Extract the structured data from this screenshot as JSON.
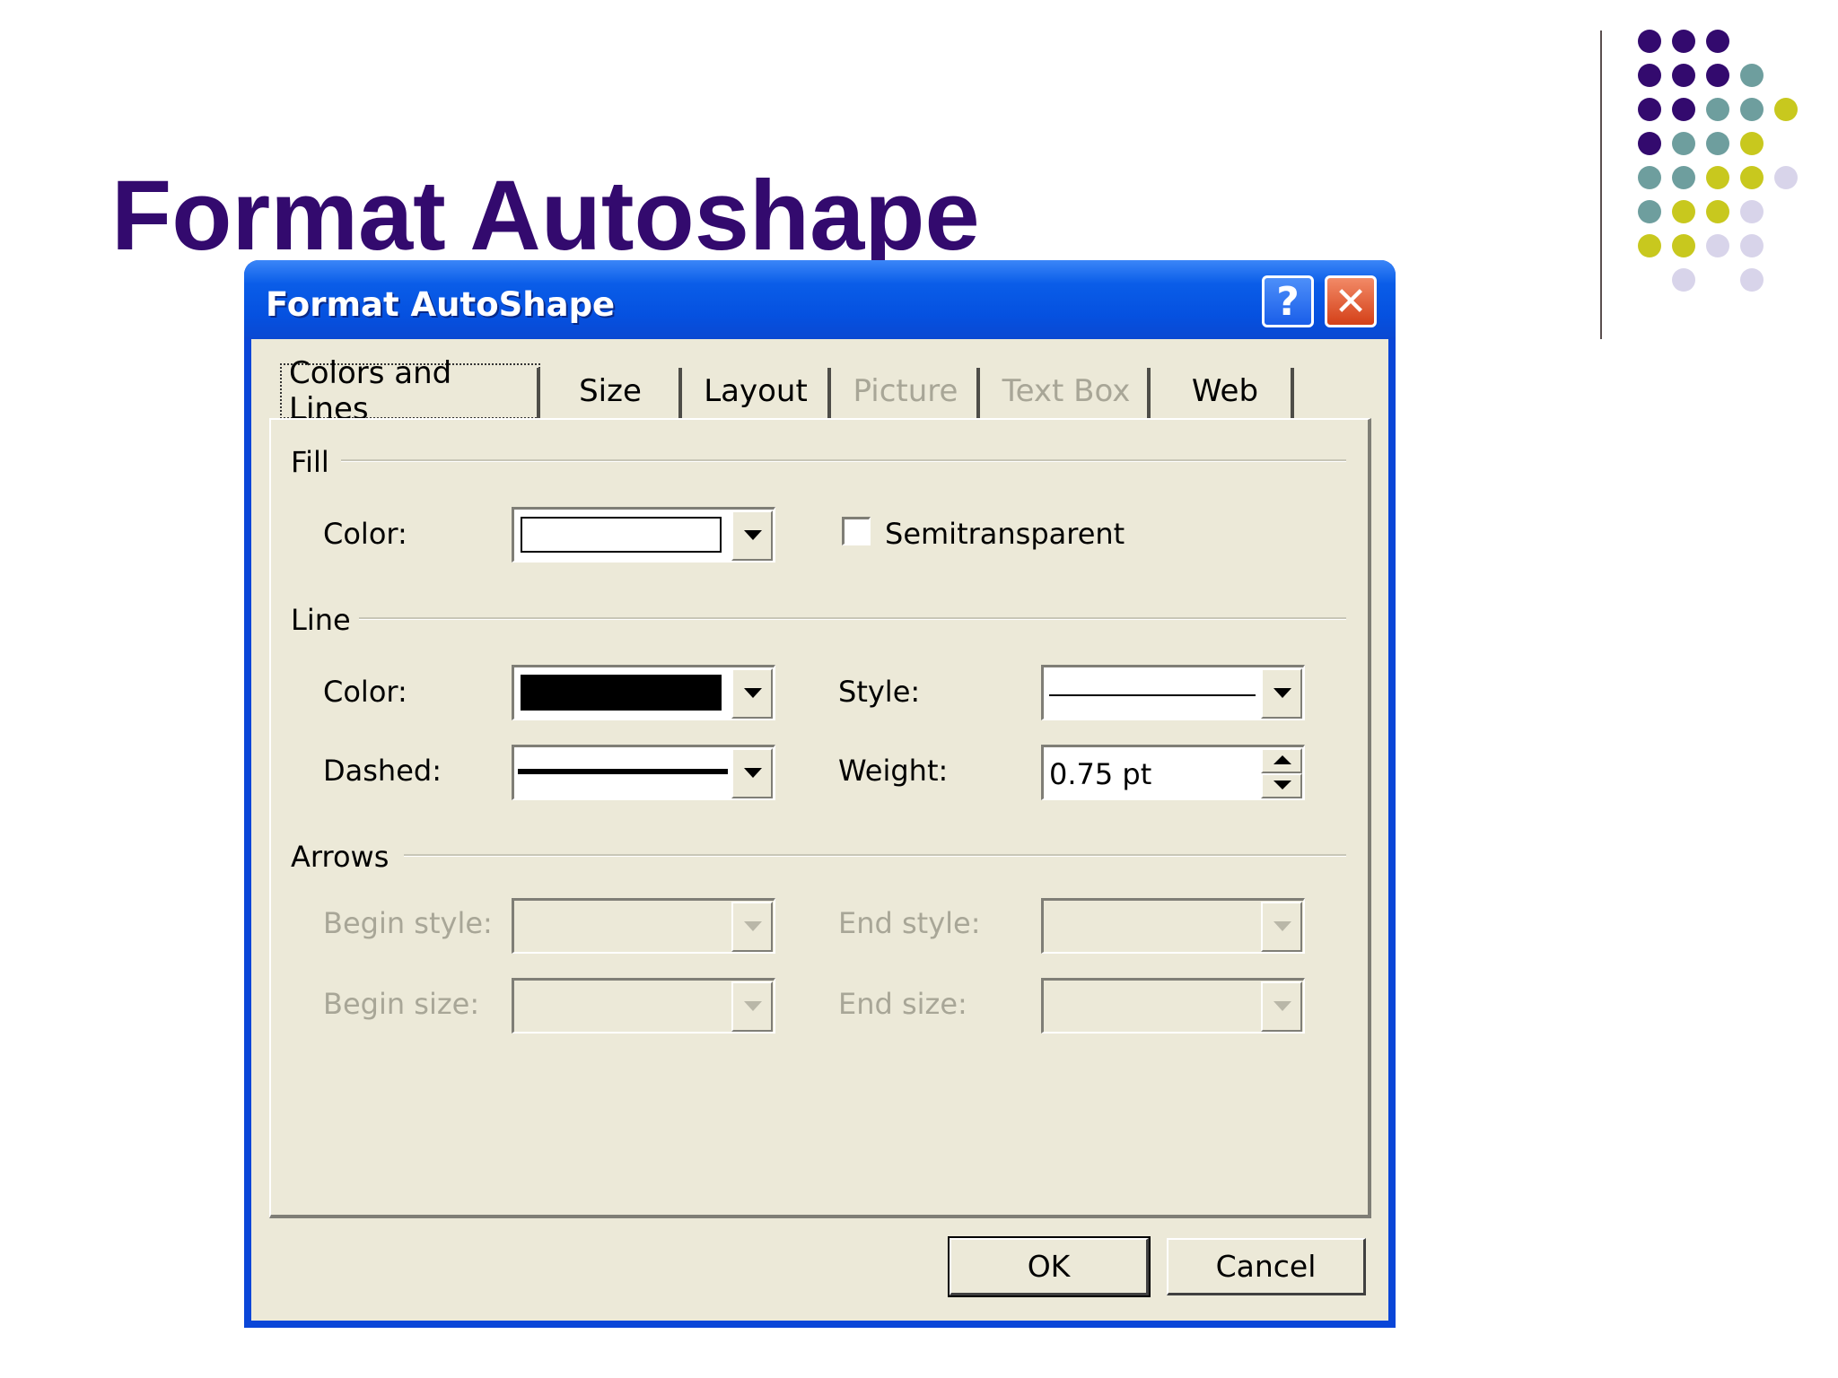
{
  "slide": {
    "title": "Format Autoshape"
  },
  "decor": {
    "dot_colors": {
      "purple": "#330a6e",
      "teal": "#6e9e9e",
      "yellow": "#c8c81e",
      "lavender": "#d8d4ea"
    }
  },
  "dialog": {
    "title": "Format AutoShape",
    "help_label": "?",
    "close_label": "✕",
    "tabs": [
      {
        "label": "Colors and Lines",
        "active": true,
        "enabled": true
      },
      {
        "label": "Size",
        "active": false,
        "enabled": true
      },
      {
        "label": "Layout",
        "active": false,
        "enabled": true
      },
      {
        "label": "Picture",
        "active": false,
        "enabled": false
      },
      {
        "label": "Text Box",
        "active": false,
        "enabled": false
      },
      {
        "label": "Web",
        "active": false,
        "enabled": true
      }
    ],
    "fill": {
      "group_label": "Fill",
      "color_label": "Color:",
      "color_value": "#ffffff",
      "semitransparent_label": "Semitransparent",
      "semitransparent_checked": false
    },
    "line": {
      "group_label": "Line",
      "color_label": "Color:",
      "color_value": "#000000",
      "style_label": "Style:",
      "dashed_label": "Dashed:",
      "weight_label": "Weight:",
      "weight_value": "0.75 pt"
    },
    "arrows": {
      "group_label": "Arrows",
      "begin_style_label": "Begin style:",
      "end_style_label": "End style:",
      "begin_size_label": "Begin size:",
      "end_size_label": "End size:",
      "enabled": false
    },
    "buttons": {
      "ok": "OK",
      "cancel": "Cancel"
    }
  }
}
